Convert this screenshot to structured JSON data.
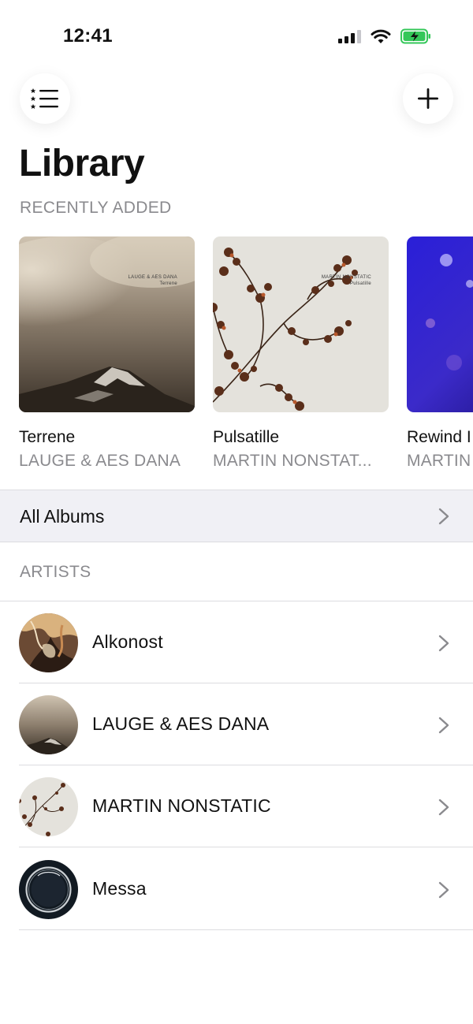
{
  "status_bar": {
    "time": "12:41",
    "icons": [
      "cellular-signal-icon",
      "wifi-icon",
      "battery-charging-icon"
    ],
    "battery_color": "#34c759"
  },
  "header": {
    "menu_icon": "starred-list-icon",
    "add_icon": "plus-icon",
    "title": "Library"
  },
  "recently_added": {
    "label": "RECENTLY ADDED",
    "albums": [
      {
        "title": "Terrene",
        "artist": "LAUGE & AES DANA",
        "art_caption_artist": "LAUGE & AES DANA",
        "art_caption_title": "Terrene"
      },
      {
        "title": "Pulsatille",
        "artist": "MARTIN NONSTAT...",
        "art_caption_artist": "MARTIN NONSTATIC",
        "art_caption_title": "Pulsatille"
      },
      {
        "title": "Rewind I",
        "artist": "MARTIN"
      }
    ]
  },
  "all_albums": {
    "label": "All Albums",
    "icon": "chevron-right-icon"
  },
  "artists": {
    "label": "ARTISTS",
    "items": [
      {
        "name": "Alkonost"
      },
      {
        "name": "LAUGE & AES DANA"
      },
      {
        "name": "MARTIN NONSTATIC"
      },
      {
        "name": "Messa"
      }
    ]
  },
  "colors": {
    "secondary_text": "#8a8a8e",
    "row_highlight": "#f0f0f5",
    "separator": "#dcdce0"
  }
}
